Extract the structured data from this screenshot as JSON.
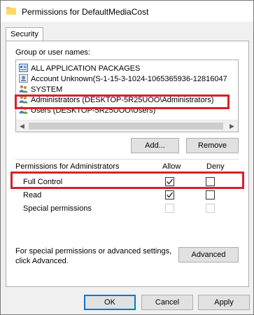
{
  "window": {
    "title": "Permissions for DefaultMediaCost"
  },
  "tabs": [
    {
      "label": "Security"
    }
  ],
  "groups": {
    "label": "Group or user names:",
    "items": [
      {
        "label": "ALL APPLICATION PACKAGES",
        "icon": "packages-icon"
      },
      {
        "label": "Account Unknown(S-1-15-3-1024-1065365936-12816047",
        "icon": "unknown-account-icon"
      },
      {
        "label": "SYSTEM",
        "icon": "user-group-icon"
      },
      {
        "label": "Administrators (DESKTOP-5R25UOO\\Administrators)",
        "icon": "user-group-icon"
      },
      {
        "label": "Users (DESKTOP-5R25UOO\\Users)",
        "icon": "user-group-icon"
      }
    ]
  },
  "buttons": {
    "add": "Add...",
    "remove": "Remove",
    "advanced": "Advanced",
    "ok": "OK",
    "cancel": "Cancel",
    "apply": "Apply"
  },
  "permissions": {
    "header": "Permissions for Administrators",
    "allow_header": "Allow",
    "deny_header": "Deny",
    "rows": [
      {
        "label": "Full Control",
        "allow": true,
        "deny": false,
        "enabled": true
      },
      {
        "label": "Read",
        "allow": true,
        "deny": false,
        "enabled": true
      },
      {
        "label": "Special permissions",
        "allow": false,
        "deny": false,
        "enabled": false
      }
    ]
  },
  "advanced_note": {
    "line1": "For special permissions or advanced settings,",
    "line2": "click Advanced."
  },
  "colors": {
    "highlight": "#d9202a",
    "default_button_border": "#0078d7"
  }
}
